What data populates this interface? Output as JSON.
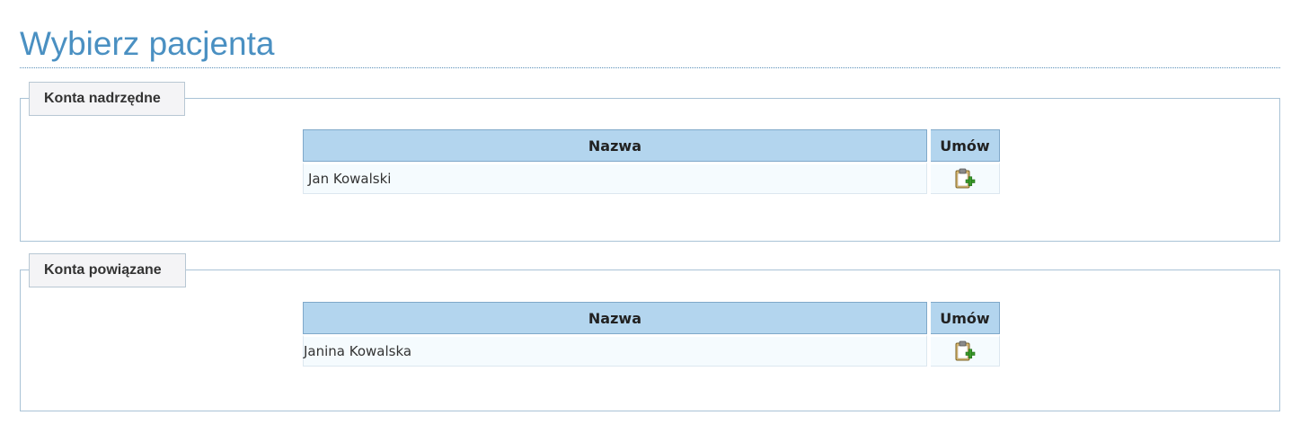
{
  "page": {
    "title": "Wybierz pacjenta"
  },
  "sections": [
    {
      "legend": "Konta nadrzędne",
      "table": {
        "columns": [
          "Nazwa",
          "Umów"
        ],
        "rows": [
          {
            "name": "Jan Kowalski",
            "action_icon": "clipboard-add-icon"
          }
        ]
      }
    },
    {
      "legend": "Konta powiązane",
      "table": {
        "columns": [
          "Nazwa",
          "Umów"
        ],
        "rows": [
          {
            "name": "Janina Kowalska",
            "action_icon": "clipboard-add-icon"
          }
        ]
      }
    }
  ],
  "colors": {
    "title": "#4a90c2",
    "header_bg": "#b3d5ee",
    "row_bg": "#f5fbfe",
    "icon_plus": "#3a9a2a"
  }
}
